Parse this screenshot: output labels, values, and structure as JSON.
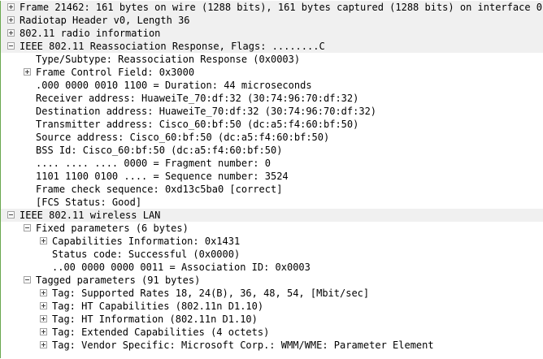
{
  "tree": {
    "rows": [
      {
        "label": "Frame 21462: 161 bytes on wire (1288 bits), 161 bytes captured (1288 bits) on interface 0"
      },
      {
        "label": "Radiotap Header v0, Length 36"
      },
      {
        "label": "802.11 radio information"
      },
      {
        "label": "IEEE 802.11 Reassociation Response, Flags: ........C"
      },
      {
        "label": "Type/Subtype: Reassociation Response (0x0003)"
      },
      {
        "label": "Frame Control Field: 0x3000"
      },
      {
        "label": ".000 0000 0010 1100 = Duration: 44 microseconds"
      },
      {
        "label": "Receiver address: HuaweiTe_70:df:32 (30:74:96:70:df:32)"
      },
      {
        "label": "Destination address: HuaweiTe_70:df:32 (30:74:96:70:df:32)"
      },
      {
        "label": "Transmitter address: Cisco_60:bf:50 (dc:a5:f4:60:bf:50)"
      },
      {
        "label": "Source address: Cisco_60:bf:50 (dc:a5:f4:60:bf:50)"
      },
      {
        "label": "BSS Id: Cisco_60:bf:50 (dc:a5:f4:60:bf:50)"
      },
      {
        "label": ".... .... .... 0000 = Fragment number: 0"
      },
      {
        "label": "1101 1100 0100 .... = Sequence number: 3524"
      },
      {
        "label": "Frame check sequence: 0xd13c5ba0 [correct]"
      },
      {
        "label": "[FCS Status: Good]"
      },
      {
        "label": "IEEE 802.11 wireless LAN"
      },
      {
        "label": "Fixed parameters (6 bytes)"
      },
      {
        "label": "Capabilities Information: 0x1431"
      },
      {
        "label": "Status code: Successful (0x0000)"
      },
      {
        "label": "..00 0000 0000 0011 = Association ID: 0x0003"
      },
      {
        "label": "Tagged parameters (91 bytes)"
      },
      {
        "label": "Tag: Supported Rates 18, 24(B), 36, 48, 54, [Mbit/sec]"
      },
      {
        "label": "Tag: HT Capabilities (802.11n D1.10)"
      },
      {
        "label": "Tag: HT Information (802.11n D1.10)"
      },
      {
        "label": "Tag: Extended Capabilities (4 octets)"
      },
      {
        "label": "Tag: Vendor Specific: Microsoft Corp.: WMM/WME: Parameter Element"
      }
    ]
  },
  "colors": {
    "top_level_row_bg": "#f0f0f0",
    "left_border": "#6aa84f",
    "expander_border": "#a0a0a0"
  }
}
